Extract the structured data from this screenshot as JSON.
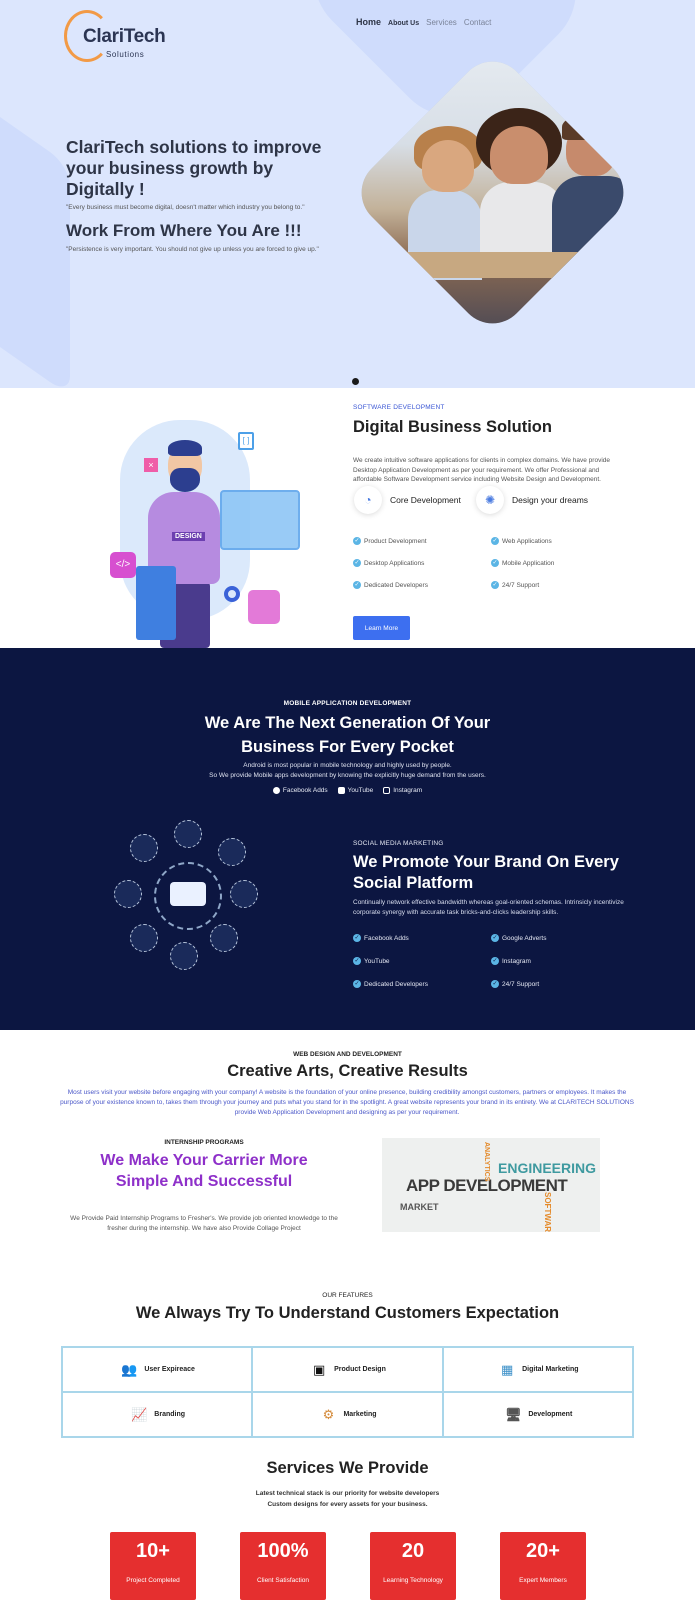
{
  "header": {
    "logo_name": "ClariTech",
    "logo_sub": "Solutions",
    "nav": [
      "Home",
      "About Us",
      "Services",
      "Contact"
    ]
  },
  "hero": {
    "title": "ClariTech solutions to improve your business growth by Digitally !",
    "quote1": "\"Every business must become digital, doesn't matter which industry you belong to.\"",
    "heading2": "Work From Where You Are !!!",
    "quote2": "\"Persistence is very important. You should not give up unless you are forced to give up.\""
  },
  "software": {
    "kicker": "SOFTWARE DEVELOPMENT",
    "title": "Digital Business Solution",
    "description": "We create intuitive software applications for clients in complex domains. We have provide Desktop Application Development as per your requirement. We offer Professional and affordable Software Development service including Website Design and Development.",
    "feature1": "Core Development",
    "feature2": "Design your dreams",
    "checks_left": [
      "Product Development",
      "Desktop Applications",
      "Dedicated Developers"
    ],
    "checks_right": [
      "Web Applications",
      "Mobile Application",
      "24/7 Support"
    ],
    "button": "Learn More"
  },
  "mobile": {
    "kicker": "MOBILE APPLICATION DEVELOPMENT",
    "title": "We Are The Next Generation Of Your Business For Every Pocket",
    "desc_line1": "Android is most popular in mobile technology and highly used by people.",
    "desc_line2": "So We provide Mobile apps development by knowing the explicitly huge demand from the users.",
    "social": [
      "Facebook Adds",
      "YouTube",
      "Instagram"
    ]
  },
  "social_marketing": {
    "kicker": "SOCIAL MEDIA MARKETING",
    "title": "We Promote Your Brand On Every Social Platform",
    "description": "Continually network effective bandwidth whereas goal-oriented schemas. Intrinsicly incentivize corporate synergy with accurate task bricks-and-clicks leadership skills.",
    "checks_left": [
      "Facebook Adds",
      "YouTube",
      "Dedicated Developers"
    ],
    "checks_right": [
      "Google Adverts",
      "Instagram",
      "24/7 Support"
    ]
  },
  "web_design": {
    "kicker": "WEB DESIGN AND DEVELOPMENT",
    "title": "Creative Arts, Creative Results",
    "description": "Most users visit your website before engaging with your company! A website is the foundation of your online presence, building credibility amongst customers, partners or employees. It makes the purpose of your existence known to, takes them through your journey and puts what you stand for in the spotlight. A great website represents your brand in its entirety. We at CLARITECH SOLUTIONS provide Web Application Development and designing as per your requirement."
  },
  "internship": {
    "kicker": "INTERNSHIP PROGRAMS",
    "title": "We Make Your Carrier More Simple And Successful",
    "description": "We Provide Paid Internship Programs to Fresher's. We provide job oriented knowledge to the fresher during the internship. We have also Provide Collage Project",
    "wordcloud": [
      "APP DEVELOPMENT",
      "ENGINEERING",
      "MARKET",
      "ANALYTICS",
      "SOFTWARE"
    ]
  },
  "features": {
    "kicker": "OUR FEATURES",
    "title": "We Always Try To Understand Customers Expectation",
    "items": [
      "User Expireace",
      "Product Design",
      "Digital Marketing",
      "Branding",
      "Marketing",
      "Development"
    ]
  },
  "services": {
    "title": "Services We Provide",
    "sub_line1": "Latest technical stack is our priority for website developers",
    "sub_line2": "Custom designs for every assets for your business.",
    "stats": [
      {
        "value": "10+",
        "label": "Project Completed"
      },
      {
        "value": "100%",
        "label": "Client Satisfaction"
      },
      {
        "value": "20",
        "label": "Learning Technology"
      },
      {
        "value": "20+",
        "label": "Expert Members"
      }
    ]
  },
  "colors": {
    "hero_bg": "#dce6fd",
    "dark_bg": "#0c1641",
    "accent_blue": "#3d6ff0",
    "purple": "#8e30c9",
    "stat_red": "#e52f2f"
  }
}
